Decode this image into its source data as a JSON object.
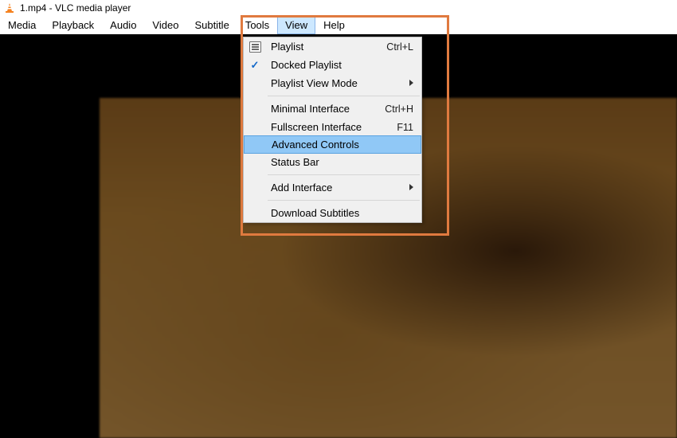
{
  "title": "1.mp4 - VLC media player",
  "menubar": {
    "media": "Media",
    "playback": "Playback",
    "audio": "Audio",
    "video": "Video",
    "subtitle": "Subtitle",
    "tools": "Tools",
    "view": "View",
    "help": "Help",
    "active": "view"
  },
  "dropdown": {
    "playlist": {
      "label": "Playlist",
      "shortcut": "Ctrl+L"
    },
    "docked_playlist": {
      "label": "Docked Playlist",
      "checked": true
    },
    "playlist_view_mode": {
      "label": "Playlist View Mode"
    },
    "minimal_interface": {
      "label": "Minimal Interface",
      "shortcut": "Ctrl+H"
    },
    "fullscreen_interface": {
      "label": "Fullscreen Interface",
      "shortcut": "F11"
    },
    "advanced_controls": {
      "label": "Advanced Controls"
    },
    "status_bar": {
      "label": "Status Bar"
    },
    "add_interface": {
      "label": "Add Interface"
    },
    "download_subtitles": {
      "label": "Download Subtitles"
    },
    "highlighted": "advanced_controls"
  }
}
